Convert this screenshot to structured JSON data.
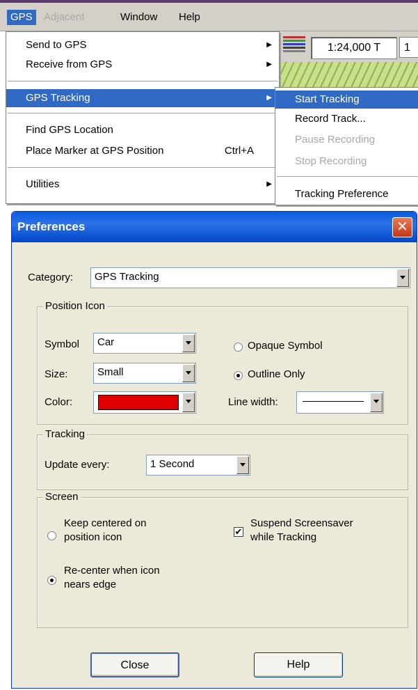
{
  "menubar": {
    "items": [
      {
        "label": "GPS",
        "state": "active"
      },
      {
        "label": "Adjacent",
        "state": "disabled"
      },
      {
        "label": "Window",
        "state": "normal"
      },
      {
        "label": "Help",
        "state": "normal"
      }
    ]
  },
  "toolbar": {
    "scale": "1:24,000 T",
    "scale_next": "1"
  },
  "gps_menu": {
    "items": [
      {
        "label": "Send to GPS",
        "submenu": true
      },
      {
        "label": "Receive from GPS",
        "submenu": true
      },
      {
        "label": "GPS Tracking",
        "submenu": true,
        "selected": true
      },
      {
        "label": "Find GPS Location"
      },
      {
        "label": "Place Marker at GPS Position",
        "shortcut": "Ctrl+A"
      },
      {
        "label": "Utilities",
        "submenu": true
      }
    ]
  },
  "tracking_submenu": {
    "items": [
      {
        "label": "Start Tracking",
        "state": "selected"
      },
      {
        "label": "Record Track...",
        "state": "normal"
      },
      {
        "label": "Pause Recording",
        "state": "disabled"
      },
      {
        "label": "Stop Recording",
        "state": "disabled"
      },
      {
        "label": "Tracking Preference",
        "state": "normal"
      }
    ]
  },
  "dialog": {
    "title": "Preferences",
    "close_glyph": "✕",
    "category_label": "Category:",
    "category_value": "GPS Tracking",
    "position_icon": {
      "legend": "Position Icon",
      "symbol_label": "Symbol",
      "symbol_value": "Car",
      "size_label": "Size:",
      "size_value": "Small",
      "color_label": "Color:",
      "color_value": "#e00000",
      "opaque_label": "Opaque Symbol",
      "opaque_selected": false,
      "outline_label": "Outline Only",
      "outline_selected": true,
      "line_width_label": "Line width:"
    },
    "tracking": {
      "legend": "Tracking",
      "update_label": "Update every:",
      "update_value": "1 Second"
    },
    "screen": {
      "legend": "Screen",
      "keep_centered_line1": "Keep centered on",
      "keep_centered_line2": "position icon",
      "keep_centered_selected": false,
      "recenter_line1": "Re-center when icon",
      "recenter_line2": "nears edge",
      "recenter_selected": true,
      "suspend_line1": "Suspend Screensaver",
      "suspend_line2": "while Tracking",
      "suspend_checked": true,
      "check_glyph": "✔"
    },
    "close_button": "Close",
    "help_button": "Help"
  },
  "colors": {
    "title_bar": "#0a5bdc",
    "menu_highlight": "#316ac5",
    "dialog_face": "#ece9d8",
    "close_button": "#c4371c"
  }
}
